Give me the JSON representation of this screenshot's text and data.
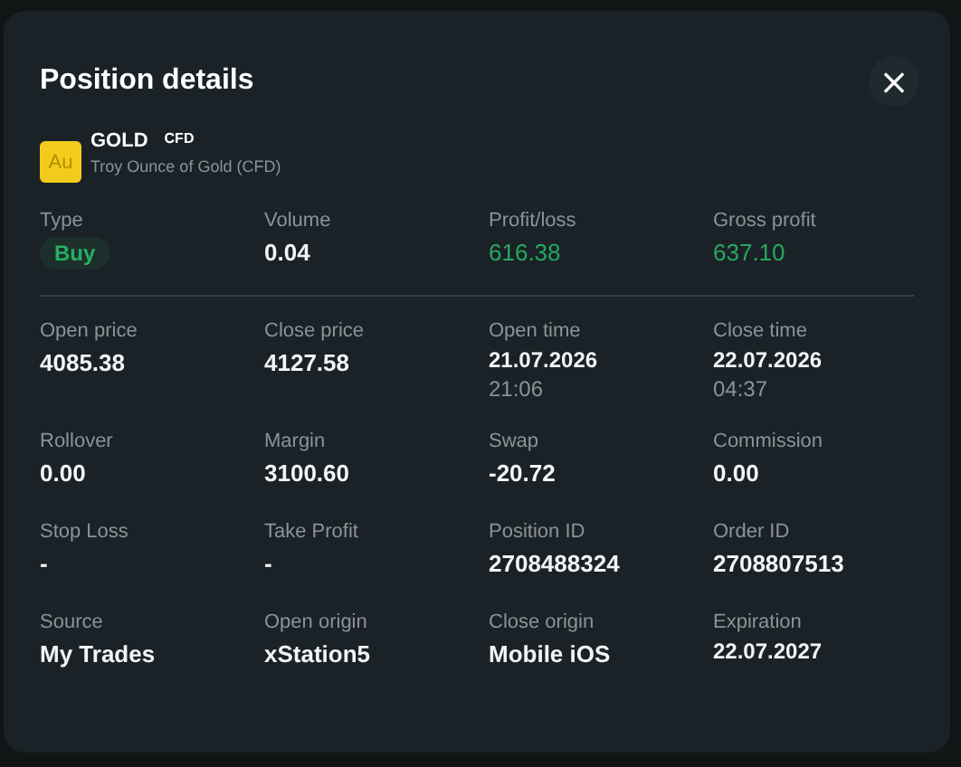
{
  "dialog": {
    "title": "Position details",
    "close": "×"
  },
  "instrument": {
    "icon": "Au",
    "symbol": "GOLD",
    "badge": "CFD",
    "description": "Troy Ounce of Gold (CFD)"
  },
  "summary": [
    {
      "label": "Type",
      "kind": "tag",
      "value": "Buy"
    },
    {
      "label": "Volume",
      "kind": "text",
      "value": "0.04"
    },
    {
      "label": "Profit/loss",
      "kind": "gain",
      "value": "616.38"
    },
    {
      "label": "Gross profit",
      "kind": "gain",
      "value": "637.10"
    }
  ],
  "details": [
    {
      "label": "Open price",
      "kind": "text",
      "value": "4085.38"
    },
    {
      "label": "Close price",
      "kind": "text",
      "value": "4127.58"
    },
    {
      "label": "Open time",
      "kind": "datetime",
      "value": "21.07.2026",
      "time": "21:06"
    },
    {
      "label": "Close time",
      "kind": "datetime",
      "value": "22.07.2026",
      "time": "04:37"
    },
    {
      "label": "Rollover",
      "kind": "text",
      "value": "0.00"
    },
    {
      "label": "Margin",
      "kind": "text",
      "value": "3100.60"
    },
    {
      "label": "Swap",
      "kind": "text",
      "value": "-20.72"
    },
    {
      "label": "Commission",
      "kind": "text",
      "value": "0.00"
    },
    {
      "label": "Stop Loss",
      "kind": "text",
      "value": "-"
    },
    {
      "label": "Take Profit",
      "kind": "text",
      "value": "-"
    },
    {
      "label": "Position ID",
      "kind": "text",
      "value": "2708488324"
    },
    {
      "label": "Order ID",
      "kind": "text",
      "value": "2708807513"
    },
    {
      "label": "Source",
      "kind": "text",
      "value": "My Trades"
    },
    {
      "label": "Open origin",
      "kind": "text",
      "value": "xStation5"
    },
    {
      "label": "Close origin",
      "kind": "text",
      "value": "Mobile iOS"
    },
    {
      "label": "Expiration",
      "kind": "datetime",
      "value": "22.07.2027"
    }
  ]
}
